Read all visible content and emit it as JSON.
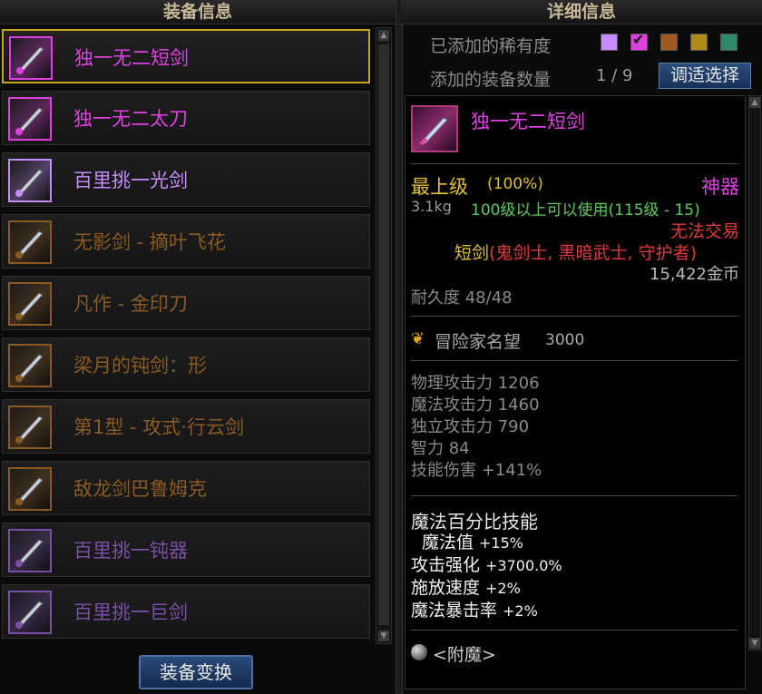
{
  "panels": {
    "left_title": "装备信息",
    "right_title": "详细信息"
  },
  "colors": {
    "epic": "#e040e0",
    "legendary_purple": "#c58cff",
    "unique_brown": "#9a6a2a",
    "gold": "#e0c030",
    "red": "#e03a3a",
    "green": "#5acd5a"
  },
  "items": [
    {
      "name": "独一无二短剑",
      "color": "#e040e0",
      "icon": "dagger-icon",
      "selected": true
    },
    {
      "name": "独一无二太刀",
      "color": "#e040e0",
      "icon": "katana-icon",
      "selected": false
    },
    {
      "name": "百里挑一光剑",
      "color": "#c58cff",
      "icon": "lightsaber-icon",
      "selected": false
    },
    {
      "name": "无影剑 - 摘叶飞花",
      "color": "#8a5a22",
      "icon": "sword-icon",
      "selected": false
    },
    {
      "name": "凡作 - 金印刀",
      "color": "#8a5a22",
      "icon": "blade-icon",
      "selected": false
    },
    {
      "name": "梁月的钝剑：形",
      "color": "#8a5a22",
      "icon": "blunt-sword-icon",
      "selected": false
    },
    {
      "name": "第1型 - 攻式·行云剑",
      "color": "#8a5a22",
      "icon": "sword-icon",
      "selected": false
    },
    {
      "name": "敌龙剑巴鲁姆克",
      "color": "#8a5a22",
      "icon": "dragon-sword-icon",
      "selected": false
    },
    {
      "name": "百里挑一钝器",
      "color": "#7a4fa8",
      "icon": "club-icon",
      "selected": false
    },
    {
      "name": "百里挑一巨剑",
      "color": "#7a4fa8",
      "icon": "greatsword-icon",
      "selected": false
    }
  ],
  "swap_button": "装备变换",
  "rarity": {
    "label": "已添加的稀有度",
    "swatches": [
      {
        "color": "#c58cff",
        "checked": false
      },
      {
        "color": "#e040e0",
        "checked": true
      },
      {
        "color": "#a05a20",
        "checked": false
      },
      {
        "color": "#b08a18",
        "checked": false
      },
      {
        "color": "#2f8a6a",
        "checked": false
      }
    ]
  },
  "count": {
    "label": "添加的装备数量",
    "value": "1 / 9",
    "button": "调适选择"
  },
  "detail": {
    "name": "独一无二短剑",
    "grade": "最上级",
    "grade_pct": "(100%)",
    "type_tag": "神器",
    "weight": "3.1kg",
    "level_req": "100级以上可以使用(115级 - 15)",
    "trade": "无法交易",
    "class_prefix": "短剑",
    "class_restrict": "(鬼剑士, 黑暗武士, 守护者)",
    "price": "15,422金币",
    "durability": "耐久度 48/48",
    "fame_label": "冒险家名望",
    "fame_value": "3000",
    "stats": [
      "物理攻击力 1206",
      "魔法攻击力 1460",
      "独立攻击力 790",
      "智力 84",
      "技能伤害 +141%"
    ],
    "skill_title": "魔法百分比技能",
    "skills": [
      {
        "name": "魔法值",
        "value": "+15%"
      },
      {
        "name": "攻击强化",
        "value": "+3700.0%"
      },
      {
        "name": "施放速度",
        "value": "+2%"
      },
      {
        "name": "魔法暴击率",
        "value": "+2%"
      }
    ],
    "enchant": "<附魔>"
  }
}
